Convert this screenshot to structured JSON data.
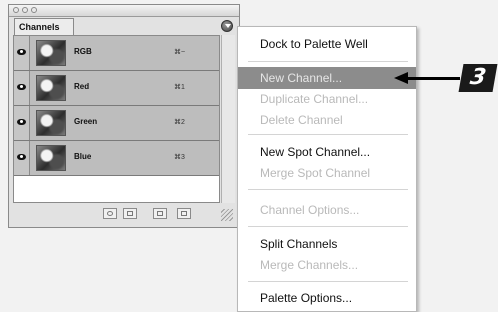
{
  "palette": {
    "tab_label": "Channels",
    "channels": [
      {
        "name": "RGB",
        "shortcut": "⌘~"
      },
      {
        "name": "Red",
        "shortcut": "⌘1"
      },
      {
        "name": "Green",
        "shortcut": "⌘2"
      },
      {
        "name": "Blue",
        "shortcut": "⌘3"
      }
    ],
    "bottom_buttons": [
      "load-selection-icon",
      "save-selection-icon",
      "new-channel-icon",
      "trash-icon"
    ]
  },
  "menu": {
    "items": [
      {
        "label": "Dock to Palette Well",
        "enabled": true
      },
      {
        "label": "New Channel...",
        "enabled": true,
        "highlighted": true
      },
      {
        "label": "Duplicate Channel...",
        "enabled": false
      },
      {
        "label": "Delete Channel",
        "enabled": false
      },
      {
        "label": "New Spot Channel...",
        "enabled": true
      },
      {
        "label": "Merge Spot Channel",
        "enabled": false
      },
      {
        "label": "Channel Options...",
        "enabled": false
      },
      {
        "label": "Split Channels",
        "enabled": true
      },
      {
        "label": "Merge Channels...",
        "enabled": false
      },
      {
        "label": "Palette Options...",
        "enabled": true
      }
    ]
  },
  "callout": {
    "step": "3"
  }
}
